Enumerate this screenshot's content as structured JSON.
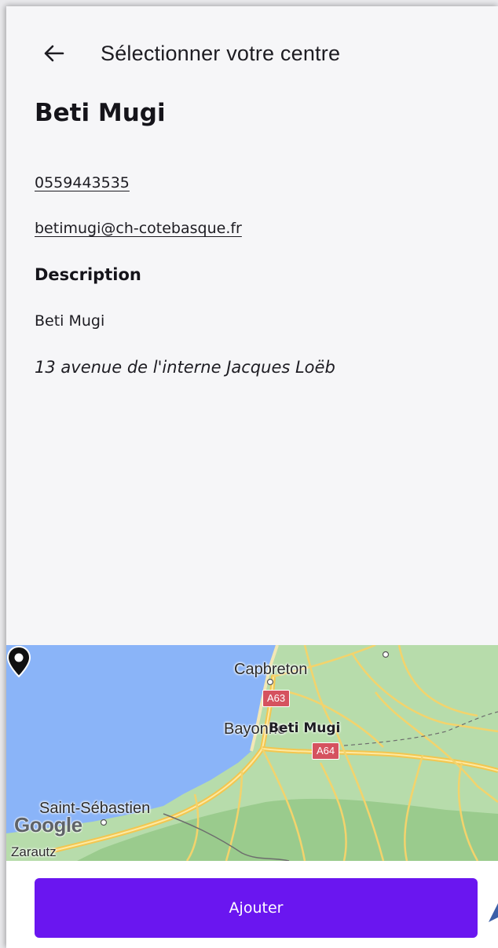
{
  "header": {
    "title": "Sélectionner votre centre",
    "back_icon": "arrow-left-icon"
  },
  "center": {
    "name": "Beti Mugi",
    "phone": "0559443535",
    "email": "betimugi@ch-cotebasque.fr",
    "description_title": "Description",
    "description": "Beti Mugi",
    "address": "13 avenue de l'interne Jacques Loëb"
  },
  "map": {
    "labels": {
      "capbreton": "Capbreton",
      "bayonne": "Bayonne",
      "saint_sebastien": "Saint-Sébastien",
      "zarautz": "Zarautz",
      "a63": "A63",
      "a64": "A64",
      "google": "Google"
    },
    "marker_label": "Beti Mugi",
    "colors": {
      "water": "#8ab4f8",
      "land": "#a9d2a0",
      "roads": "#f3c64f"
    }
  },
  "footer": {
    "add_label": "Ajouter"
  },
  "colors": {
    "primary": "#6a16f0",
    "background": "#f6f6f8",
    "text": "#1c1b22"
  }
}
